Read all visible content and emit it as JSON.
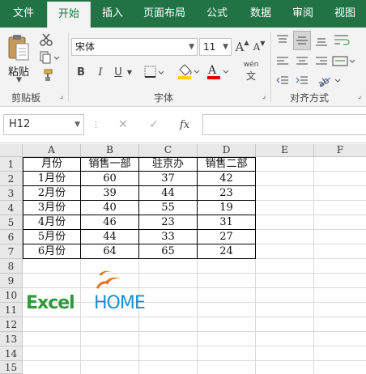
{
  "tabs": [
    "文件",
    "开始",
    "插入",
    "页面布局",
    "公式",
    "数据",
    "审阅",
    "视图"
  ],
  "ribbon": {
    "paste_label": "粘贴",
    "clipboard_label": "剪贴板",
    "font_label": "字体",
    "align_label": "对齐方式",
    "font_name": "宋体",
    "font_size": "11",
    "bold": "B",
    "italic": "I",
    "underline": "U",
    "font_color_letter": "A",
    "grow_font": "A",
    "shrink_font": "A",
    "phonetic": "wén",
    "accent_yellow": "#ffd200",
    "accent_red": "#e00000"
  },
  "formula_bar": {
    "name_box": "H12",
    "fx_label": "fx",
    "cancel": "✕",
    "confirm": "✓",
    "formula": ""
  },
  "columns": [
    "A",
    "B",
    "C",
    "D",
    "E",
    "F"
  ],
  "rows": [
    "1",
    "2",
    "3",
    "4",
    "5",
    "6",
    "7",
    "8",
    "9",
    "10",
    "11",
    "12",
    "13",
    "14",
    "15"
  ],
  "table": {
    "headers": [
      "月份",
      "销售一部",
      "驻京办",
      "销售二部"
    ],
    "rows": [
      [
        "1月份",
        "60",
        "37",
        "42"
      ],
      [
        "2月份",
        "39",
        "44",
        "23"
      ],
      [
        "3月份",
        "40",
        "55",
        "19"
      ],
      [
        "4月份",
        "46",
        "23",
        "31"
      ],
      [
        "5月份",
        "44",
        "33",
        "27"
      ],
      [
        "6月份",
        "64",
        "65",
        "24"
      ]
    ]
  },
  "logo": {
    "text_left": "Excel",
    "text_right": "HOME",
    "color_green": "#2e9a3a",
    "color_blue": "#1a8fd0",
    "color_orange": "#e8741e"
  }
}
